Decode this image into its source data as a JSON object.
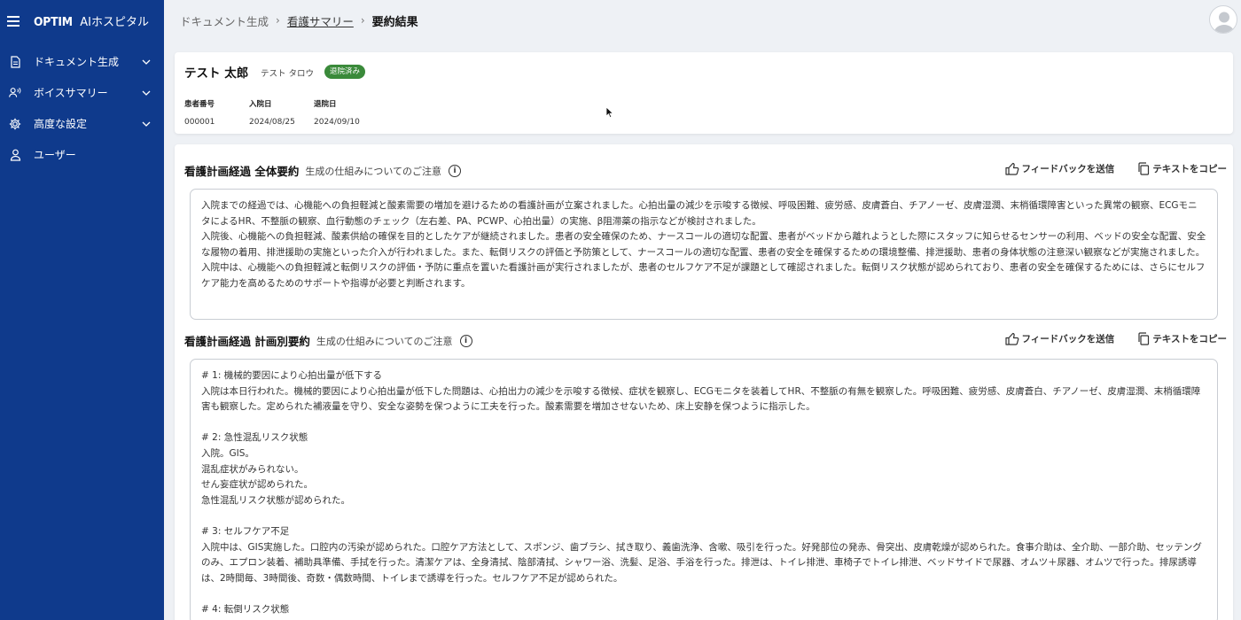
{
  "app": {
    "logo_brand": "OPTIM",
    "logo_product": "AIホスピタル"
  },
  "sidebar": {
    "items": [
      {
        "label": "ドキュメント生成",
        "icon": "document-icon",
        "expandable": true
      },
      {
        "label": "ボイスサマリー",
        "icon": "voice-icon",
        "expandable": true
      },
      {
        "label": "高度な設定",
        "icon": "gear-icon",
        "expandable": true
      },
      {
        "label": "ユーザー",
        "icon": "user-icon",
        "expandable": false
      }
    ]
  },
  "breadcrumb": {
    "items": [
      "ドキュメント生成",
      "看護サマリー"
    ],
    "current": "要約結果"
  },
  "patient": {
    "name": "テスト 太郎",
    "kana": "テスト タロウ",
    "status_badge": "退院済み",
    "fields": [
      {
        "label": "患者番号",
        "value": "000001"
      },
      {
        "label": "入院日",
        "value": "2024/08/25"
      },
      {
        "label": "退院日",
        "value": "2024/09/10"
      }
    ]
  },
  "sections": [
    {
      "title": "看護計画経過 全体要約",
      "note": "生成の仕組みについてのご注意",
      "feedback_label": "フィードバックを送信",
      "copy_label": "テキストをコピー",
      "text": "入院までの経過では、心機能への負担軽減と酸素需要の増加を避けるための看護計画が立案されました。心拍出量の減少を示唆する徴候、呼吸困難、疲労感、皮膚蒼白、チアノーゼ、皮膚湿潤、末梢循環障害といった異常の観察、ECGモニタによるHR、不整脈の観察、血行動態のチェック（左右差、PA、PCWP、心拍出量）の実施、β阻滞薬の指示などが検討されました。\n入院後、心機能への負担軽減、酸素供給の確保を目的としたケアが継続されました。患者の安全確保のため、ナースコールの適切な配置、患者がベッドから離れようとした際にスタッフに知らせるセンサーの利用、ベッドの安全な配置、安全な履物の着用、排泄援助の実施といった介入が行われました。また、転倒リスクの評価と予防策として、ナースコールの適切な配置、患者の安全を確保するための環境整備、排泄援助、患者の身体状態の注意深い観察などが実施されました。\n入院中は、心機能への負担軽減と転倒リスクの評価・予防に重点を置いた看護計画が実行されましたが、患者のセルフケア不足が課題として確認されました。転倒リスク状態が認められており、患者の安全を確保するためには、さらにセルフケア能力を高めるためのサポートや指導が必要と判断されます。"
    },
    {
      "title": "看護計画経過 計画別要約",
      "note": "生成の仕組みについてのご注意",
      "feedback_label": "フィードバックを送信",
      "copy_label": "テキストをコピー",
      "text": "# 1: 機械的要因により心拍出量が低下する\n入院は本日行われた。機械的要因により心拍出量が低下した問題は、心拍出力の減少を示唆する徴候、症状を観察し、ECGモニタを装着してHR、不整脈の有無を観察した。呼吸困難、疲労感、皮膚蒼白、チアノーゼ、皮膚湿潤、末梢循環障害も観察した。定められた補液量を守り、安全な姿勢を保つように工夫を行った。酸素需要を増加させないため、床上安静を保つように指示した。\n\n# 2: 急性混乱リスク状態\n入院。GIS。\n混乱症状がみられない。\nせん妄症状が認められた。\n急性混乱リスク状態が認められた。\n\n# 3: セルフケア不足\n入院中は、GIS実施した。口腔内の汚染が認められた。口腔ケア方法として、スポンジ、歯ブラシ、拭き取り、義歯洗浄、含嗽、吸引を行った。好発部位の発赤、骨突出、皮膚乾燥が認められた。食事介助は、全介助、一部介助、セッテングのみ、エプロン装着、補助具準備、手拭を行った。清潔ケアは、全身清拭、陰部清拭、シャワー浴、洗髪、足浴、手浴を行った。排泄は、トイレ排泄、車椅子でトイレ排泄、ベッドサイドで尿器、オムツ＋尿器、オムツで行った。排尿誘導は、2時間毎、3時間後、奇数・偶数時間、トイレまで誘導を行った。セルフケア不足が認められた。\n\n# 4: 転倒リスク状態"
    }
  ]
}
